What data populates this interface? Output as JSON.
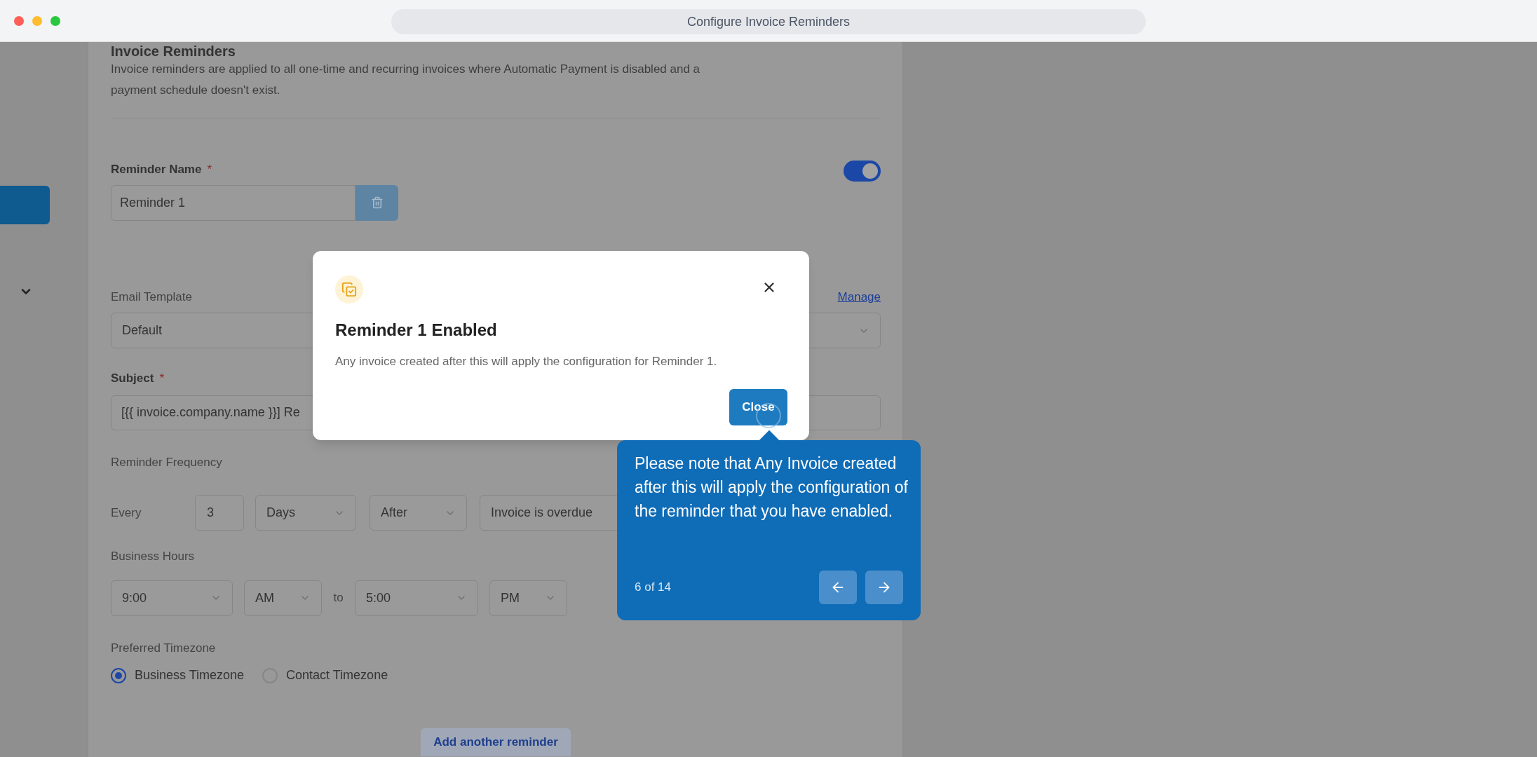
{
  "window": {
    "title": "Configure Invoice Reminders"
  },
  "form": {
    "heading": "Invoice Reminders",
    "description": "Invoice reminders are applied to all one-time and recurring invoices where Automatic Payment is disabled and a payment schedule doesn't exist.",
    "reminder_name": {
      "label": "Reminder Name",
      "marker": "*",
      "value": "Reminder 1"
    },
    "enabled": {
      "on": true
    },
    "email_template": {
      "label": "Email Template",
      "link": "Manage",
      "value": "Default"
    },
    "subject": {
      "label": "Subject",
      "marker": "*",
      "value": "[{{ invoice.company.name }}] Re"
    },
    "frequency": {
      "label": "Reminder Frequency",
      "every": "Every",
      "count": "3",
      "unit": "Days",
      "relation": "After",
      "trigger": "Invoice is overdue"
    },
    "business_hours": {
      "label": "Business Hours",
      "from": "9:00",
      "from_period": "AM",
      "to": "to",
      "until": "5:00",
      "until_period": "PM"
    },
    "timezone": {
      "label": "Preferred Timezone",
      "options": [
        {
          "label": "Business Timezone",
          "selected": true
        },
        {
          "label": "Contact Timezone",
          "selected": false
        }
      ]
    },
    "add_button": "Add another reminder"
  },
  "modal": {
    "title": "Reminder 1 Enabled",
    "message": "Any invoice created after this will apply the configuration for Reminder 1.",
    "close_button": "Close"
  },
  "tour": {
    "text": "Please note that Any Invoice created after this will apply the configuration of the reminder that you have enabled.",
    "step": "6 of 14"
  }
}
